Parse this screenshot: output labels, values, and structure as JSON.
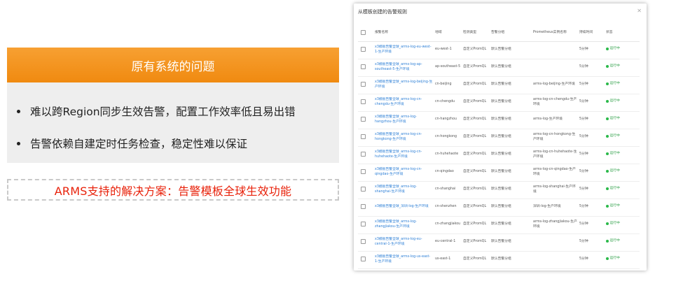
{
  "slide": {
    "problem_title": "原有系统的问题",
    "bullets": [
      "难以跨Region同步生效告警，配置工作效率低且易出错",
      "告警依赖自建定时任务检查，稳定性难以保证"
    ],
    "solution_text": "ARMS支持的解决方案：告警模板全球生效功能",
    "colors": {
      "header_orange": "#f08a10",
      "solution_red": "#e8210a",
      "card_gray": "#eeeeee"
    }
  },
  "dialog": {
    "title": "从模板创建的告警规则",
    "close_icon": "close-icon",
    "columns": [
      "报警名称",
      "地域",
      "检测类型",
      "告警分组",
      "Prometheus实例名称",
      "持续时间",
      "状态"
    ],
    "rows": [
      {
        "name": "x3模板告警全球_arms-log-eu-west-1-生产环境",
        "region": "eu-west-1",
        "type": "自定义PromQL",
        "group": "默认告警分组",
        "prom": "",
        "duration": "5分钟",
        "status": "运行中"
      },
      {
        "name": "x3模板告警全球_arms-log-ap-southeast-5-生产环境",
        "region": "ap-southeast-5",
        "type": "自定义PromQL",
        "group": "默认告警分组",
        "prom": "",
        "duration": "5分钟",
        "status": "运行中"
      },
      {
        "name": "x3模板告警全球_arms-log-beijing-生产环境",
        "region": "cn-beijing",
        "type": "自定义PromQL",
        "group": "默认告警分组",
        "prom": "arms-log-beijing-生产环境",
        "duration": "5分钟",
        "status": "运行中"
      },
      {
        "name": "x3模板告警全球_arms-log-cn-chengdu-生产环境",
        "region": "cn-chengdu",
        "type": "自定义PromQL",
        "group": "默认告警分组",
        "prom": "arms-log-cn-chengdu-生产环境",
        "duration": "5分钟",
        "status": "运行中"
      },
      {
        "name": "x3模板告警全球_arms-log-hangzhou-生产环境",
        "region": "cn-hangzhou",
        "type": "自定义PromQL",
        "group": "默认告警分组",
        "prom": "arms-log-生产环境",
        "duration": "5分钟",
        "status": "运行中"
      },
      {
        "name": "x3模板告警全球_arms-log-cn-hongkong-生产环境",
        "region": "cn-hongkong",
        "type": "自定义PromQL",
        "group": "默认告警分组",
        "prom": "arms-log-cn-hongkong-生产环境",
        "duration": "5分钟",
        "status": "运行中"
      },
      {
        "name": "x3模板告警全球_arms-log-cn-huhehaote-生产环境",
        "region": "cn-huhehaote",
        "type": "自定义PromQL",
        "group": "默认告警分组",
        "prom": "arms-log-cn-huhehaote-生产环境",
        "duration": "5分钟",
        "status": "运行中"
      },
      {
        "name": "x3模板告警全球_arms-log-cn-qingdao-生产环境",
        "region": "cn-qingdao",
        "type": "自定义PromQL",
        "group": "默认告警分组",
        "prom": "arms-log-cn-qingdao-生产环境",
        "duration": "5分钟",
        "status": "运行中"
      },
      {
        "name": "x3模板告警全球_arms-log-shanghai-生产环境",
        "region": "cn-shanghai",
        "type": "自定义PromQL",
        "group": "默认告警分组",
        "prom": "arms-log-shanghai-生产环境",
        "duration": "5分钟",
        "status": "运行中"
      },
      {
        "name": "x3模板告警全球_深圳-log-生产环境",
        "region": "cn-shenzhen",
        "type": "自定义PromQL",
        "group": "默认告警分组",
        "prom": "深圳-log-生产环境",
        "duration": "5分钟",
        "status": "运行中"
      },
      {
        "name": "x3模板告警全球_arms-log-zhangjiakou-生产环境",
        "region": "cn-zhangjiakou",
        "type": "自定义PromQL",
        "group": "默认告警分组",
        "prom": "arms-log-zhangjiakou-生产环境",
        "duration": "5分钟",
        "status": "运行中"
      },
      {
        "name": "x3模板告警全球_arms-log-eu-central-1-生产环境",
        "region": "eu-central-1",
        "type": "自定义PromQL",
        "group": "默认告警分组",
        "prom": "",
        "duration": "5分钟",
        "status": "运行中"
      },
      {
        "name": "x3模板告警全球_arms-log-us-east-1-生产环境",
        "region": "us-east-1",
        "type": "自定义PromQL",
        "group": "默认告警分组",
        "prom": "",
        "duration": "5分钟",
        "status": "运行中"
      }
    ],
    "colors": {
      "link_blue": "#2d7fd6",
      "status_green": "#2bb94a"
    }
  }
}
